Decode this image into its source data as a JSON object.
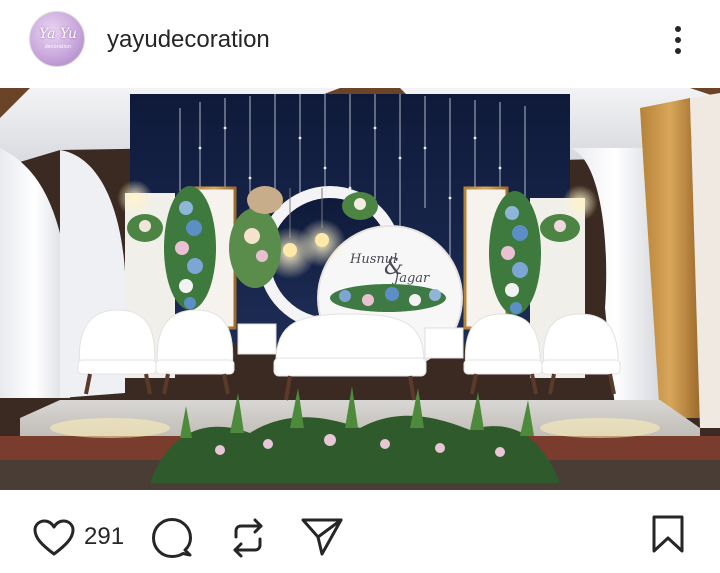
{
  "post": {
    "username": "yayudecoration",
    "avatar_text": "Ya Yu",
    "avatar_sub": "decoration",
    "like_count": "291",
    "photo_signage": {
      "line1": "Husnul",
      "amp": "&",
      "line2": "Jagar"
    }
  },
  "icons": {
    "more": "more-options-icon",
    "like": "heart-icon",
    "comment": "comment-icon",
    "repost": "repost-icon",
    "share": "send-icon",
    "save": "bookmark-icon"
  },
  "colors": {
    "text": "#262626",
    "background": "#ffffff"
  }
}
